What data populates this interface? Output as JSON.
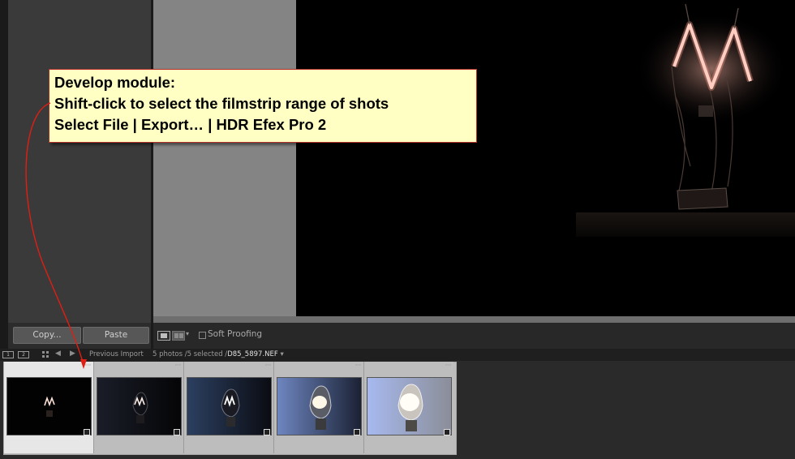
{
  "develop": {
    "left_panel": {
      "copy_label": "Copy...",
      "paste_label": "Paste"
    },
    "toolbar": {
      "soft_proofing_label": "Soft Proofing",
      "soft_proofing_checked": false
    }
  },
  "filmstrip_bar": {
    "monitor_1": "1",
    "monitor_2": "2",
    "source_label": "Previous Import",
    "selection_info": "5 photos /5 selected /",
    "filename": "D85_5897.NEF"
  },
  "filmstrip": {
    "thumbnails": [
      {
        "name": "exposure-1",
        "selected": true
      },
      {
        "name": "exposure-2",
        "selected": false
      },
      {
        "name": "exposure-3",
        "selected": false
      },
      {
        "name": "exposure-4",
        "selected": false
      },
      {
        "name": "exposure-5",
        "selected": false
      }
    ]
  },
  "callout": {
    "line1": "Develop module:",
    "line2": "Shift-click to select the filmstrip range of shots",
    "line3": "Select File | Export… | HDR Efex Pro 2",
    "border_color": "#b3302b",
    "fill_color": "#ffffc4",
    "arrow_color": "#e01e12"
  },
  "icons": {
    "loupe": "loupe-view-icon",
    "compare": "compare-view-icon",
    "grid": "grid-icon",
    "back": "back-arrow-icon",
    "forward": "forward-arrow-icon"
  }
}
